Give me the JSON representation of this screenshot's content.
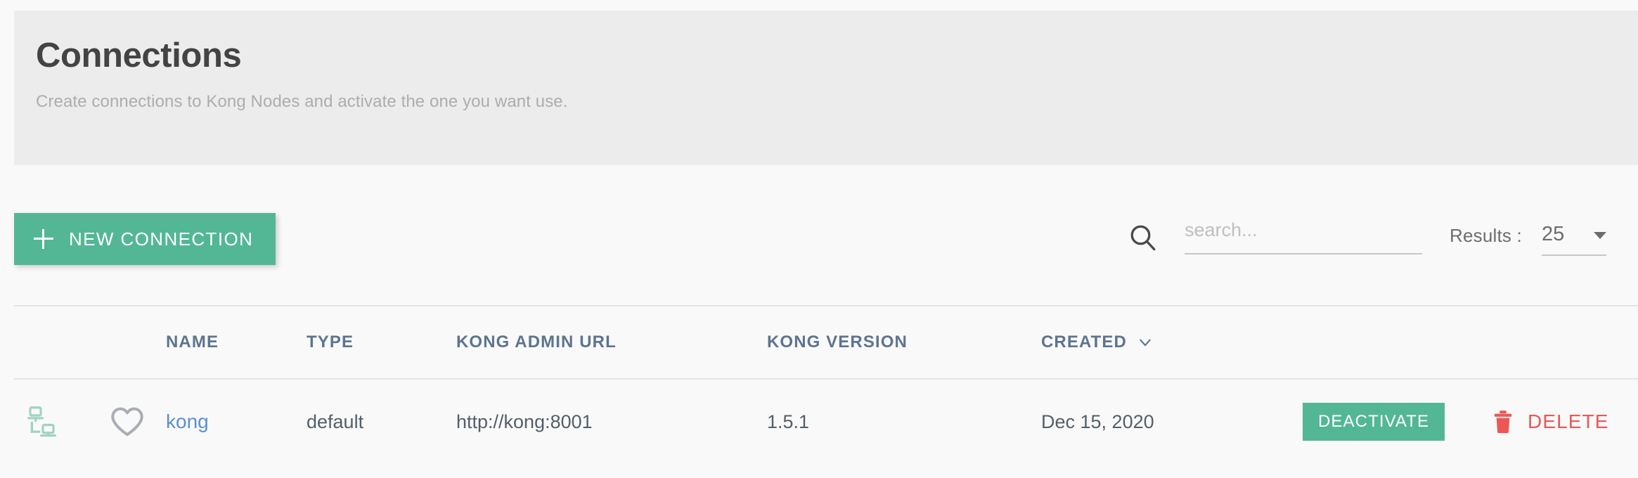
{
  "header": {
    "title": "Connections",
    "subtitle": "Create connections to Kong Nodes and activate the one you want use.",
    "background_color": "#ececec"
  },
  "toolbar": {
    "new_connection_label": "NEW CONNECTION",
    "new_connection_color": "#53b795",
    "plus_icon": "plus-icon",
    "search": {
      "icon": "search-icon",
      "value": "",
      "placeholder": "search..."
    },
    "results": {
      "label": "Results :",
      "value": "25",
      "caret_icon": "chevron-down-icon"
    }
  },
  "table": {
    "columns": [
      {
        "key": "icon",
        "label": ""
      },
      {
        "key": "favorite",
        "label": ""
      },
      {
        "key": "name",
        "label": "NAME"
      },
      {
        "key": "type",
        "label": "TYPE"
      },
      {
        "key": "admin_url",
        "label": "KONG ADMIN URL"
      },
      {
        "key": "version",
        "label": "KONG VERSION"
      },
      {
        "key": "created",
        "label": "CREATED",
        "sorted": true,
        "sort_icon": "chevron-down-icon"
      },
      {
        "key": "action_primary",
        "label": ""
      },
      {
        "key": "action_delete",
        "label": ""
      }
    ],
    "header_text_color": "#5d7490",
    "rows": [
      {
        "icon": "network-node-icon",
        "favorite_icon": "heart-outline-icon",
        "name": "kong",
        "type": "default",
        "admin_url": "http://kong:8001",
        "version": "1.5.1",
        "created": "Dec 15, 2020",
        "action_primary": "DEACTIVATE",
        "action_primary_color": "#53b795",
        "action_delete": "DELETE",
        "action_delete_color": "#eb5757",
        "delete_icon": "trash-icon"
      }
    ]
  }
}
